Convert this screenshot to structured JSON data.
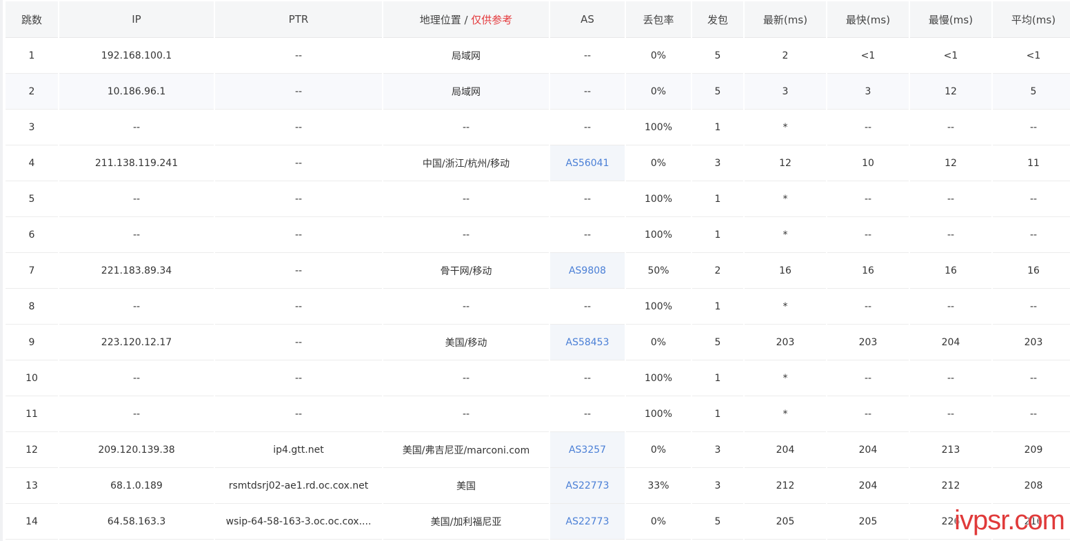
{
  "table": {
    "headers": {
      "hop": "跳数",
      "ip": "IP",
      "ptr": "PTR",
      "geo_main": "地理位置 / ",
      "geo_note": "仅供参考",
      "as": "AS",
      "loss": "丢包率",
      "sent": "发包",
      "last": "最新(ms)",
      "best": "最快(ms)",
      "worst": "最慢(ms)",
      "avg": "平均(ms)"
    },
    "rows": [
      {
        "hop": "1",
        "ip": "192.168.100.1",
        "ptr": "--",
        "geo": "局域网",
        "as": "--",
        "loss": "0%",
        "sent": "5",
        "last": "2",
        "best": "<1",
        "worst": "<1",
        "avg": "<1"
      },
      {
        "hop": "2",
        "ip": "10.186.96.1",
        "ptr": "--",
        "geo": "局域网",
        "as": "--",
        "loss": "0%",
        "sent": "5",
        "last": "3",
        "best": "3",
        "worst": "12",
        "avg": "5"
      },
      {
        "hop": "3",
        "ip": "--",
        "ptr": "--",
        "geo": "--",
        "as": "--",
        "loss": "100%",
        "sent": "1",
        "last": "*",
        "best": "--",
        "worst": "--",
        "avg": "--"
      },
      {
        "hop": "4",
        "ip": "211.138.119.241",
        "ptr": "--",
        "geo": "中国/浙江/杭州/移动",
        "as": "AS56041",
        "loss": "0%",
        "sent": "3",
        "last": "12",
        "best": "10",
        "worst": "12",
        "avg": "11"
      },
      {
        "hop": "5",
        "ip": "--",
        "ptr": "--",
        "geo": "--",
        "as": "--",
        "loss": "100%",
        "sent": "1",
        "last": "*",
        "best": "--",
        "worst": "--",
        "avg": "--"
      },
      {
        "hop": "6",
        "ip": "--",
        "ptr": "--",
        "geo": "--",
        "as": "--",
        "loss": "100%",
        "sent": "1",
        "last": "*",
        "best": "--",
        "worst": "--",
        "avg": "--"
      },
      {
        "hop": "7",
        "ip": "221.183.89.34",
        "ptr": "--",
        "geo": "骨干网/移动",
        "as": "AS9808",
        "loss": "50%",
        "sent": "2",
        "last": "16",
        "best": "16",
        "worst": "16",
        "avg": "16"
      },
      {
        "hop": "8",
        "ip": "--",
        "ptr": "--",
        "geo": "--",
        "as": "--",
        "loss": "100%",
        "sent": "1",
        "last": "*",
        "best": "--",
        "worst": "--",
        "avg": "--"
      },
      {
        "hop": "9",
        "ip": "223.120.12.17",
        "ptr": "--",
        "geo": "美国/移动",
        "as": "AS58453",
        "loss": "0%",
        "sent": "5",
        "last": "203",
        "best": "203",
        "worst": "204",
        "avg": "203"
      },
      {
        "hop": "10",
        "ip": "--",
        "ptr": "--",
        "geo": "--",
        "as": "--",
        "loss": "100%",
        "sent": "1",
        "last": "*",
        "best": "--",
        "worst": "--",
        "avg": "--"
      },
      {
        "hop": "11",
        "ip": "--",
        "ptr": "--",
        "geo": "--",
        "as": "--",
        "loss": "100%",
        "sent": "1",
        "last": "*",
        "best": "--",
        "worst": "--",
        "avg": "--"
      },
      {
        "hop": "12",
        "ip": "209.120.139.38",
        "ptr": "ip4.gtt.net",
        "geo": "美国/弗吉尼亚/marconi.com",
        "as": "AS3257",
        "loss": "0%",
        "sent": "3",
        "last": "204",
        "best": "204",
        "worst": "213",
        "avg": "209"
      },
      {
        "hop": "13",
        "ip": "68.1.0.189",
        "ptr": "rsmtdsrj02-ae1.rd.oc.cox.net",
        "geo": "美国",
        "as": "AS22773",
        "loss": "33%",
        "sent": "3",
        "last": "212",
        "best": "204",
        "worst": "212",
        "avg": "208"
      },
      {
        "hop": "14",
        "ip": "64.58.163.3",
        "ptr": "wsip-64-58-163-3.oc.oc.cox....",
        "geo": "美国/加利福尼亚",
        "as": "AS22773",
        "loss": "0%",
        "sent": "5",
        "last": "205",
        "best": "205",
        "worst": "226",
        "avg": "216"
      }
    ]
  },
  "watermark": "ivpsr.com",
  "colors": {
    "link": "#4a7fd6",
    "note_red": "#e4393c",
    "watermark": "#e03a3a",
    "header_bg": "#f5f6f7"
  }
}
